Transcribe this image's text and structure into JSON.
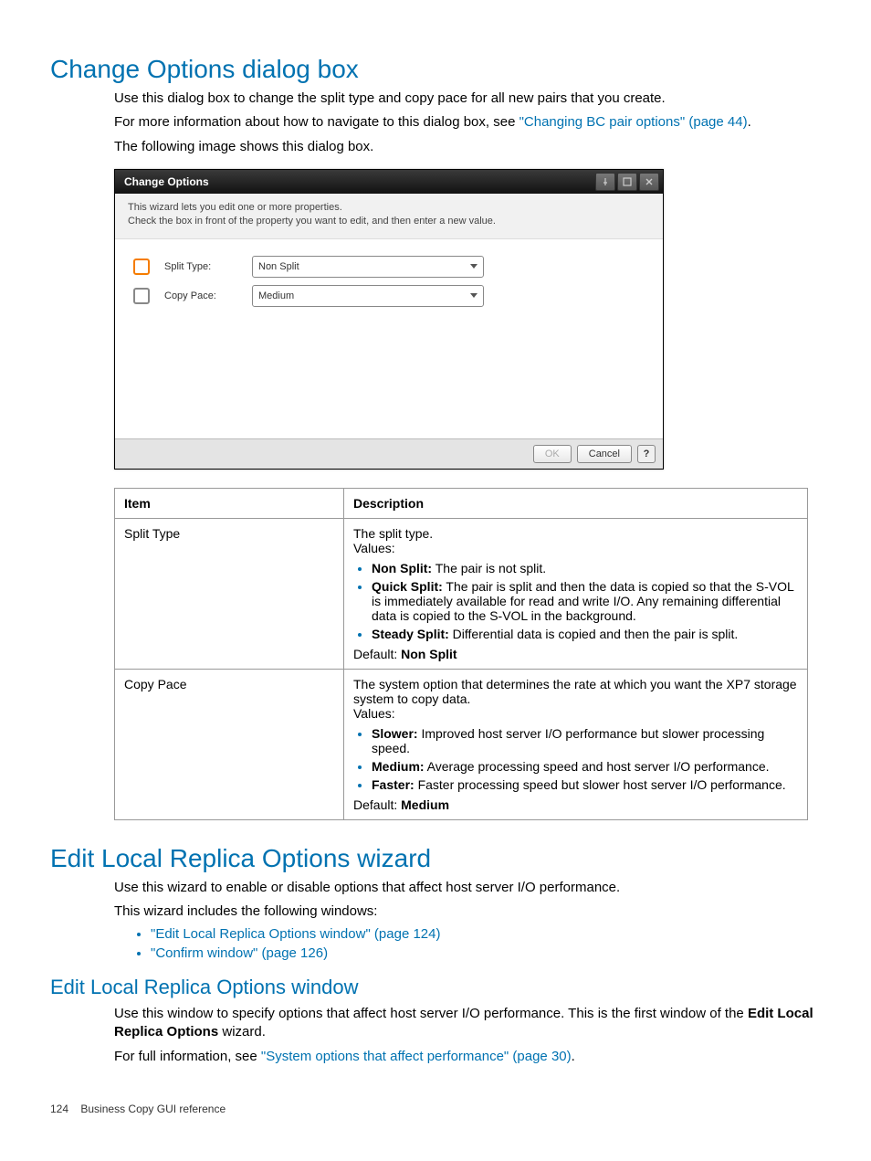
{
  "section1": {
    "heading": "Change Options dialog box",
    "p1": "Use this dialog box to change the split type and copy pace for all new pairs that you create.",
    "p2a": "For more information about how to navigate to this dialog box, see ",
    "p2link": "\"Changing BC pair options\" (page 44)",
    "p2b": ".",
    "p3": "The following image shows this dialog box."
  },
  "dialog": {
    "title": "Change Options",
    "desc1": "This wizard lets you edit one or more properties.",
    "desc2": "Check the box in front of the property you want to edit, and then enter a new value.",
    "row1_label": "Split Type:",
    "row1_value": "Non Split",
    "row2_label": "Copy Pace:",
    "row2_value": "Medium",
    "ok": "OK",
    "cancel": "Cancel",
    "help": "?"
  },
  "table": {
    "h1": "Item",
    "h2": "Description",
    "r1c1": "Split Type",
    "r1_intro": "The split type.",
    "r1_values": "Values:",
    "r1_b1_k": "Non Split:",
    "r1_b1_v": " The pair is not split.",
    "r1_b2_k": "Quick Split:",
    "r1_b2_v": " The pair is split and then the data is copied so that the S-VOL is immediately available for read and write I/O. Any remaining differential data is copied to the S-VOL in the background.",
    "r1_b3_k": "Steady Split:",
    "r1_b3_v": " Differential data is copied and then the pair is split.",
    "r1_def_a": "Default: ",
    "r1_def_b": "Non Split",
    "r2c1": "Copy Pace",
    "r2_intro": "The system option that determines the rate at which you want the XP7 storage system to copy data.",
    "r2_values": "Values:",
    "r2_b1_k": "Slower:",
    "r2_b1_v": " Improved host server I/O performance but slower processing speed.",
    "r2_b2_k": "Medium:",
    "r2_b2_v": " Average processing speed and host server I/O performance.",
    "r2_b3_k": "Faster:",
    "r2_b3_v": " Faster processing speed but slower host server I/O performance.",
    "r2_def_a": "Default: ",
    "r2_def_b": "Medium"
  },
  "section2": {
    "heading": "Edit Local Replica Options wizard",
    "p1": "Use this wizard to enable or disable options that affect host server I/O performance.",
    "p2": "This wizard includes the following windows:",
    "b1": "\"Edit Local Replica Options window\" (page 124)",
    "b2": "\"Confirm window\" (page 126)"
  },
  "section3": {
    "heading": "Edit Local Replica Options window",
    "p1a": "Use this window to specify options that affect host server I/O performance. This is the first window of the ",
    "p1b": "Edit Local Replica Options",
    "p1c": " wizard.",
    "p2a": "For full information, see ",
    "p2link": "\"System options that affect performance\" (page 30)",
    "p2b": "."
  },
  "footer": {
    "pagenum": "124",
    "section": "Business Copy GUI reference"
  }
}
